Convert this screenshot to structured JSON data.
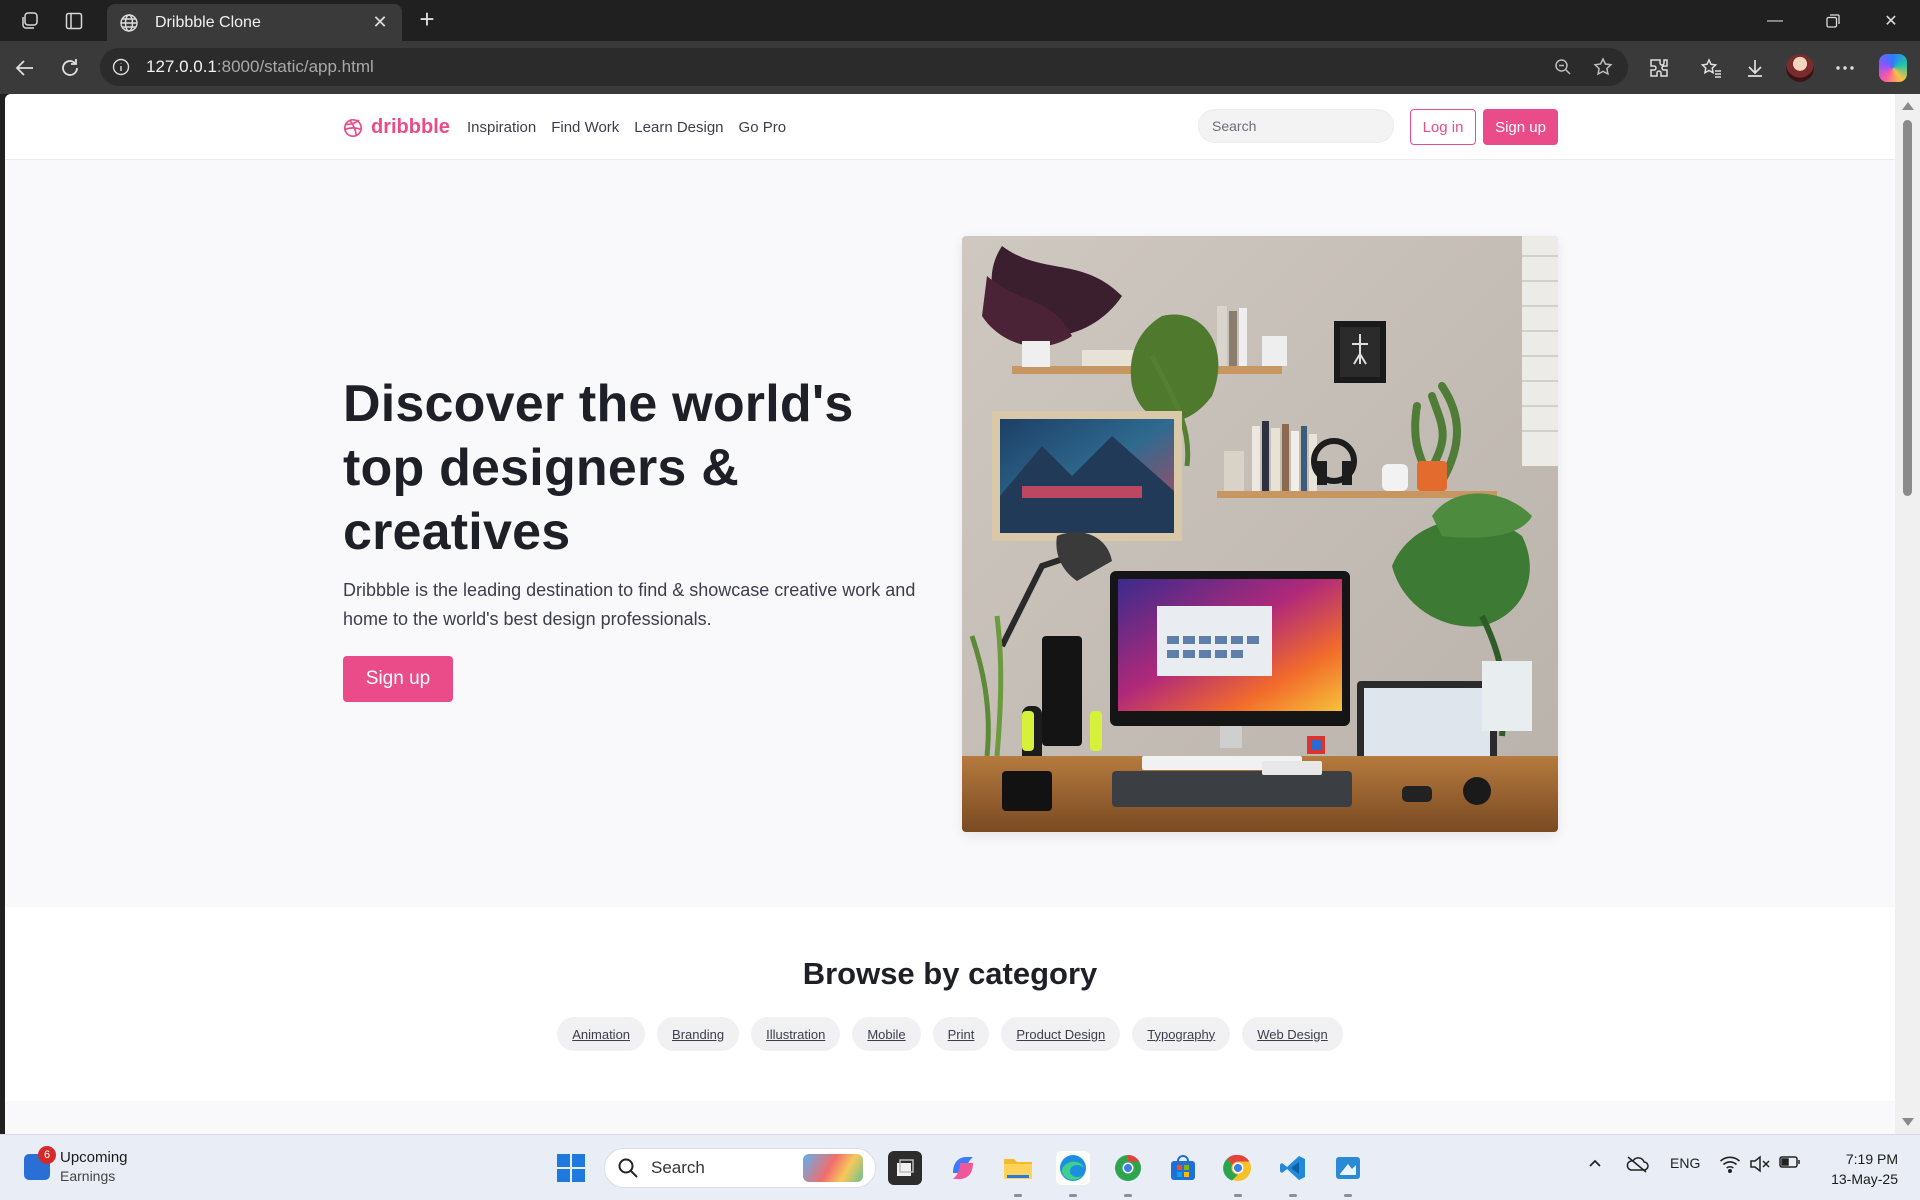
{
  "browser": {
    "tab_title": "Dribbble Clone",
    "url_host": "127.0.0.1",
    "url_rest": ":8000/static/app.html"
  },
  "site": {
    "logo_text": "dribbble",
    "nav": [
      "Inspiration",
      "Find Work",
      "Learn Design",
      "Go Pro"
    ],
    "search_placeholder": "Search",
    "login_label": "Log in",
    "signup_label": "Sign up",
    "brand_color": "#ea4c89"
  },
  "hero": {
    "title": "Discover the world's top designers & creatives",
    "subtitle": "Dribbble is the leading destination to find & showcase creative work and home to the world's best design professionals.",
    "cta_label": "Sign up"
  },
  "categories": {
    "title": "Browse by category",
    "items": [
      "Animation",
      "Branding",
      "Illustration",
      "Mobile",
      "Print",
      "Product Design",
      "Typography",
      "Web Design"
    ]
  },
  "taskbar": {
    "widget_badge": "6",
    "widget_line1": "Upcoming",
    "widget_line2": "Earnings",
    "search_label": "Search",
    "language": "ENG",
    "time": "7:19 PM",
    "date": "13-May-25"
  }
}
